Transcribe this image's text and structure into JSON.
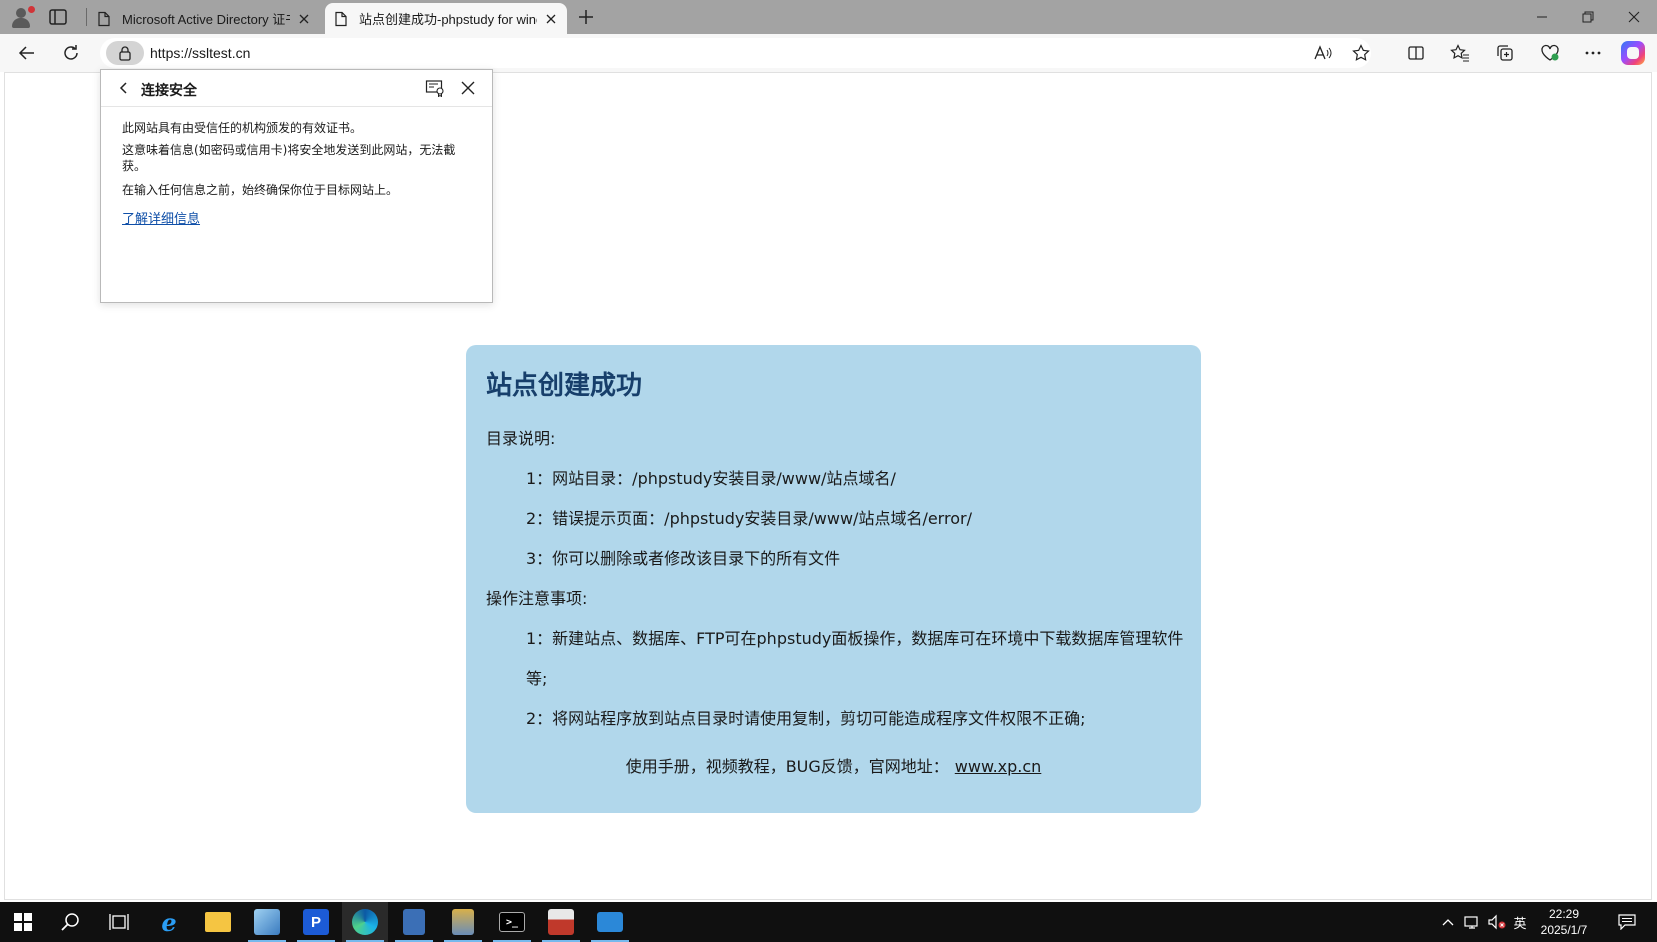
{
  "browser": {
    "tabs": [
      {
        "title": "Microsoft Active Directory 证书服"
      },
      {
        "title": "站点创建成功-phpstudy for windc"
      }
    ],
    "url": "https://ssltest.cn"
  },
  "security_popup": {
    "title": "连接安全",
    "line1": "此网站具有由受信任的机构颁发的有效证书。",
    "line2": "这意味着信息(如密码或信用卡)将安全地发送到此网站，无法截获。",
    "line3": "在输入任何信息之前，始终确保你位于目标网站上。",
    "link": "了解详细信息"
  },
  "page": {
    "title": "站点创建成功",
    "dir_heading": "目录说明:",
    "dir_items": [
      "1：网站目录：/phpstudy安装目录/www/站点域名/",
      "2：错误提示页面：/phpstudy安装目录/www/站点域名/error/",
      "3：你可以删除或者修改该目录下的所有文件"
    ],
    "notes_heading": "操作注意事项:",
    "note1_line1": "1：新建站点、数据库、FTP可在phpstudy面板操作，数据库可在环境中下载数据库管理软件",
    "note1_line2": "等;",
    "note2": "2：将网站程序放到站点目录时请使用复制，剪切可能造成程序文件权限不正确;",
    "footer_text": "使用手册，视频教程，BUG反馈，官网地址：",
    "footer_link": "www.xp.cn"
  },
  "taskbar": {
    "ime": "英",
    "time": "22:29",
    "date": "2025/1/7"
  },
  "colors": {
    "card_bg": "#b1d7eb",
    "title": "#173f6b",
    "link": "#0f4fa8",
    "taskbar": "#101010"
  }
}
